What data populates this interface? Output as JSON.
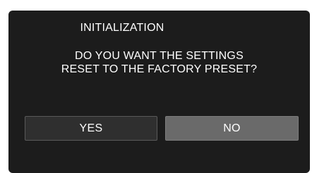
{
  "dialog": {
    "title": "INITIALIZATION",
    "message_line1": "DO YOU WANT THE SETTINGS",
    "message_line2": "RESET TO THE FACTORY PRESET?"
  },
  "buttons": {
    "yes_label": "YES",
    "no_label": "NO"
  }
}
